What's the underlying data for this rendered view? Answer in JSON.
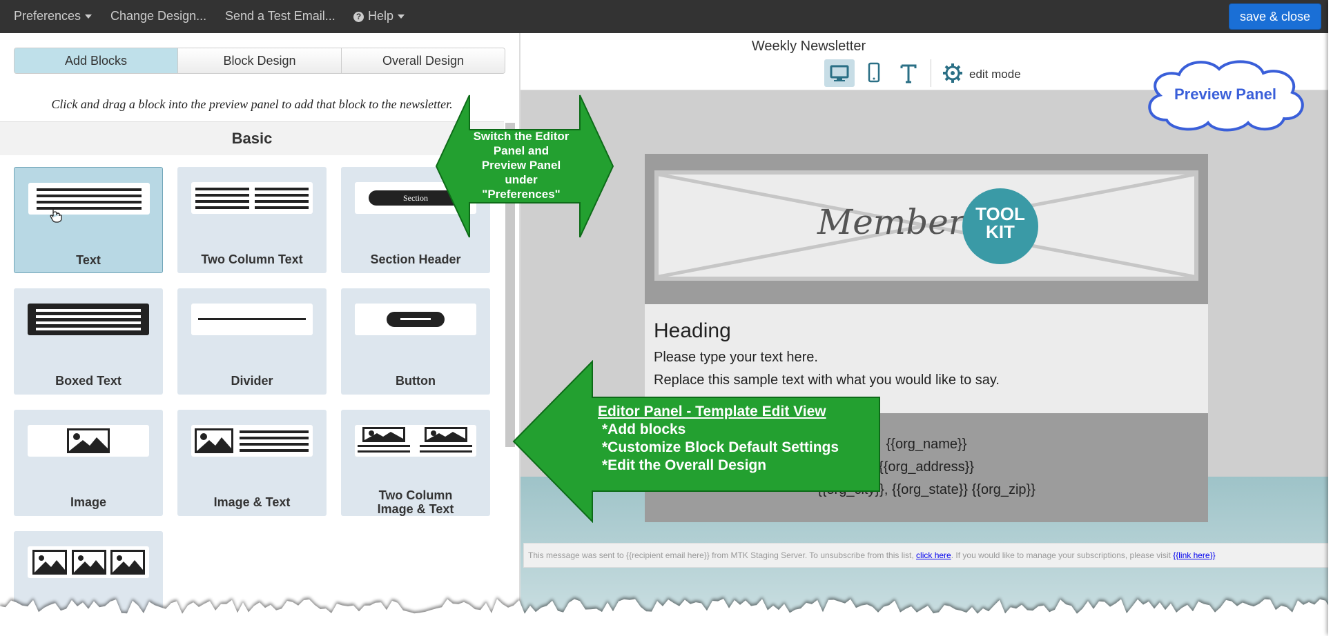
{
  "menu": {
    "preferences": "Preferences",
    "change_design": "Change Design...",
    "send_test": "Send a Test Email...",
    "help": "Help",
    "save_close": "save & close"
  },
  "editor": {
    "tabs": [
      "Add Blocks",
      "Block Design",
      "Overall Design"
    ],
    "instruction": "Click and drag a block into the preview panel to add that block to the newsletter.",
    "category": "Basic",
    "blocks": [
      {
        "label": "Text",
        "icon": "text-block-icon"
      },
      {
        "label": "Two Column Text",
        "icon": "two-column-text-icon"
      },
      {
        "label": "Section Header",
        "icon": "section-header-icon",
        "icon_text": "Section"
      },
      {
        "label": "Boxed Text",
        "icon": "boxed-text-icon"
      },
      {
        "label": "Divider",
        "icon": "divider-icon"
      },
      {
        "label": "Button",
        "icon": "button-block-icon"
      },
      {
        "label": "Image",
        "icon": "image-block-icon"
      },
      {
        "label": "Image & Text",
        "icon": "image-text-icon"
      },
      {
        "label": "Two Column Image & Text",
        "label_line1": "Two Column",
        "label_line2": "Image & Text",
        "icon": "two-column-image-text-icon"
      },
      {
        "label": "",
        "icon": "image-gallery-icon"
      }
    ]
  },
  "preview": {
    "title": "Weekly Newsletter",
    "edit_mode": "edit mode",
    "logo_script": "Membership",
    "logo_badge_line1": "TOOL",
    "logo_badge_line2": "KIT",
    "heading": "Heading",
    "para1": "Please type your text here.",
    "para2": "Replace this sample text with what you would like to say.",
    "org_name": "{{org_name}}",
    "org_address": "{{org_address}}",
    "org_city_line": "{{org_city}}, {{org_state}} {{org_zip}}",
    "footer_pre": "This message was sent to {{recipient email here}} from MTK Staging Server. To unsubscribe from this list, ",
    "footer_link1": "click here",
    "footer_mid": ". If you would like to manage your subscriptions, please visit ",
    "footer_link2": "{{link here}}"
  },
  "annotations": {
    "preview_panel": "Preview Panel",
    "switch_lines": [
      "Switch the Editor",
      "Panel and",
      "Preview Panel",
      "under",
      "\"Preferences\""
    ],
    "editor_title": "Editor Panel - Template Edit View",
    "editor_items": [
      "*Add blocks",
      "*Customize Block Default Settings",
      "*Edit the Overall Design"
    ]
  },
  "colors": {
    "topbar": "#333333",
    "save_button": "#1a6fd6",
    "active_tab": "#bfe0ea",
    "callout_green": "#23a030",
    "logo_teal": "#3a9aa6",
    "preview_blue": "#3a5fd9"
  }
}
